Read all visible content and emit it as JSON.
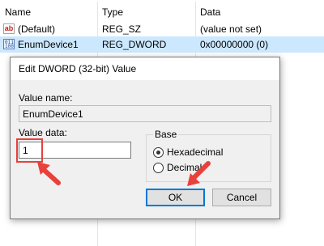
{
  "registry": {
    "columns": [
      "Name",
      "Type",
      "Data"
    ],
    "rows": [
      {
        "name": "(Default)",
        "type": "REG_SZ",
        "data": "(value not set)",
        "icon": "string-value-icon"
      },
      {
        "name": "EnumDevice1",
        "type": "REG_DWORD",
        "data": "0x00000000 (0)",
        "icon": "binary-value-icon",
        "selected": true
      }
    ]
  },
  "dialog": {
    "title": "Edit DWORD (32-bit) Value",
    "value_name_label": "Value name:",
    "value_name": "EnumDevice1",
    "value_data_label": "Value data:",
    "value_data": "1",
    "base_label": "Base",
    "base_options": [
      {
        "label": "Hexadecimal",
        "selected": true
      },
      {
        "label": "Decimal",
        "selected": false
      }
    ],
    "ok_label": "OK",
    "cancel_label": "Cancel"
  },
  "colors": {
    "selection": "#cce8ff",
    "annotation": "#e8403a",
    "default_button_border": "#0078d7"
  }
}
